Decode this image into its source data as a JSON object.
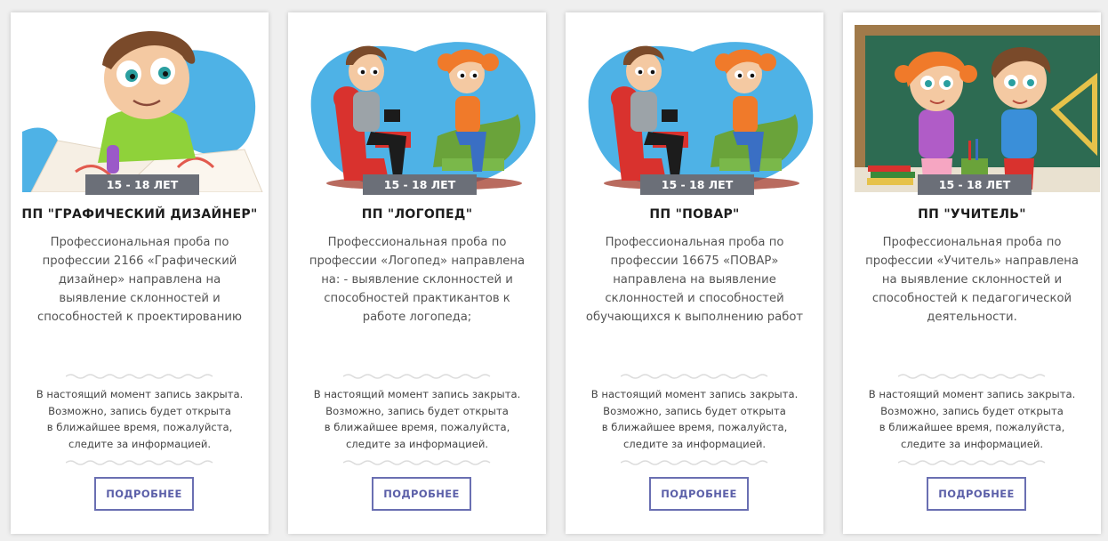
{
  "colors": {
    "page_background": "#efefef",
    "card_background": "#ffffff",
    "age_badge": "#6b6f78",
    "button_border": "#6a6fb2",
    "button_text": "#5b5fa8",
    "illustration_blue": "#4eb2e6"
  },
  "notice_lines": [
    "В настоящий момент запись закрыта.",
    "Возможно, запись будет открыта",
    "в ближайшее время, пожалуйста,",
    "следите за информацией."
  ],
  "cards": [
    {
      "image": "boy-drawing-illustration",
      "age": "15 - 18 ЛЕТ",
      "title": "ПП \"ГРАФИЧЕСКИЙ ДИЗАЙНЕР\"",
      "description_lines": [
        "Профессиональная проба по",
        "профессии 2166 «Графический",
        "дизайнер» направлена на",
        "выявление склонностей и",
        "способностей к проектированию"
      ],
      "button": "ПОДРОБНЕЕ"
    },
    {
      "image": "speech-therapist-session-illustration",
      "age": "15 - 18 ЛЕТ",
      "title": "ПП \"ЛОГОПЕД\"",
      "description_lines": [
        "Профессиональная проба по",
        "профессии «Логопед» направлена",
        "на: - выявление склонностей и",
        "способностей практикантов к",
        "работе логопеда;"
      ],
      "button": "ПОДРОБНЕЕ"
    },
    {
      "image": "speech-therapist-session-illustration",
      "age": "15 - 18 ЛЕТ",
      "title": "ПП \"ПОВАР\"",
      "description_lines": [
        "Профессиональная проба по",
        "профессии 16675 «ПОВАР»",
        "направлена на выявление",
        "склонностей и способностей",
        "обучающихся к выполнению работ"
      ],
      "button": "ПОДРОБНЕЕ"
    },
    {
      "image": "classroom-kids-illustration",
      "age": "15 - 18 ЛЕТ",
      "title": "ПП \"УЧИТЕЛЬ\"",
      "description_lines": [
        "Профессиональная проба по",
        "профессии  «Учитель» направлена",
        "на выявление склонностей и",
        "способностей к педагогической",
        "деятельности."
      ],
      "button": "ПОДРОБНЕЕ"
    }
  ]
}
